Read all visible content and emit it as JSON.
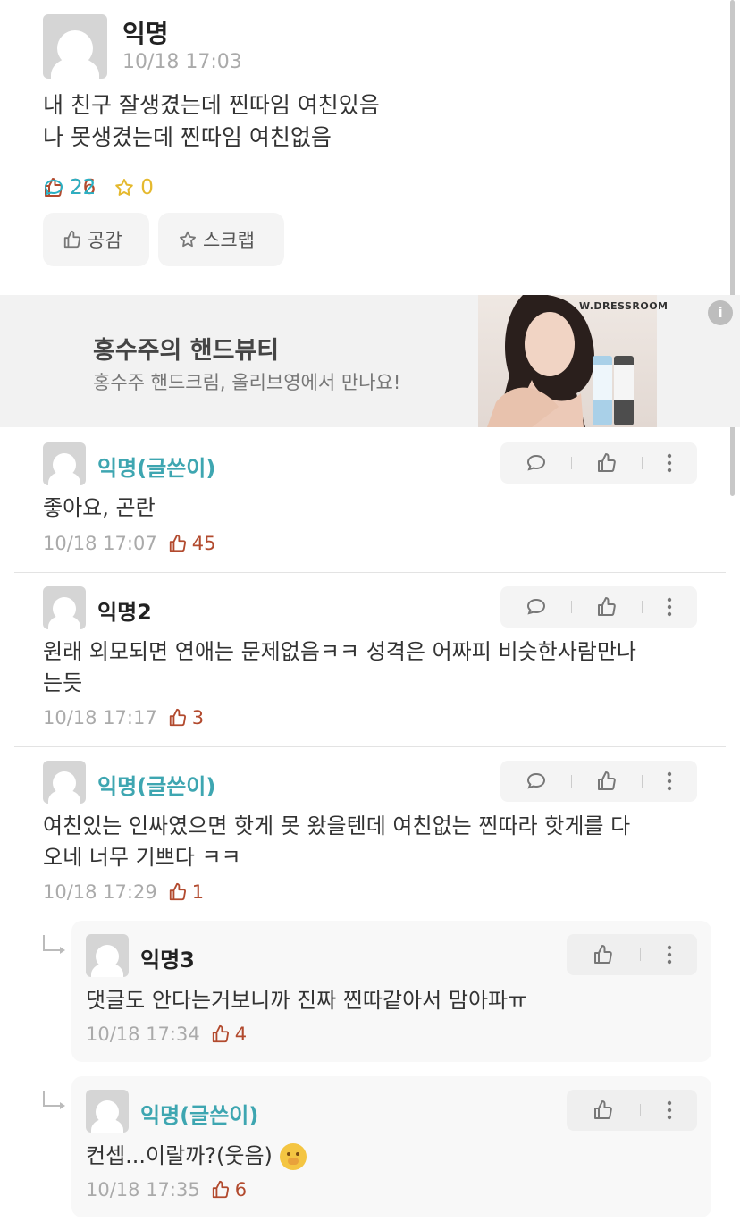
{
  "post": {
    "author": "익명",
    "time": "10/18 17:03",
    "body_line1": "내 친구 잘생겼는데 찐따임 여친있음",
    "body_line2": "나 못생겼는데 찐따임 여친없음",
    "like_count": "26",
    "comment_count": "22",
    "scrap_count": "0",
    "like_button": "공감",
    "scrap_button": "스크랩"
  },
  "ad": {
    "title": "홍수주의 핸드뷰티",
    "description": "홍수주 핸드크림, 올리브영에서 만나요!",
    "brand": "W.DRESSROOM",
    "info": "i"
  },
  "comments": [
    {
      "author": "익명(글쓴이)",
      "text_line1": "좋아요, 곤란",
      "text_line2": "",
      "time": "10/18 17:07",
      "likes": "45"
    },
    {
      "author": "익명2",
      "text_line1": "원래 외모되면 연애는 문제없음ㅋㅋ 성격은 어짜피 비슷한사람만나",
      "text_line2": "는듯",
      "time": "10/18 17:17",
      "likes": "3"
    },
    {
      "author": "익명(글쓴이)",
      "text_line1": "여친있는 인싸였으면 핫게 못 왔을텐데 여친없는 찐따라 핫게를 다",
      "text_line2": "오네 너무 기쁘다 ㅋㅋ",
      "time": "10/18 17:29",
      "likes": "1"
    }
  ],
  "replies": [
    {
      "author": "익명3",
      "text": "댓글도 안다는거보니까 진짜 찐따같아서 맘아파ㅠ",
      "time": "10/18 17:34",
      "likes": "4"
    },
    {
      "author": "익명(글쓴이)",
      "text": "컨셉...이랄까?(웃음)",
      "emoji": "shushing-face-emoji",
      "time": "10/18 17:35",
      "likes": "6"
    }
  ],
  "colors": {
    "op_name": "#3ea6b1",
    "like": "#b24a2e",
    "comment": "#2ab0c4",
    "scrap": "#e5b92e"
  }
}
